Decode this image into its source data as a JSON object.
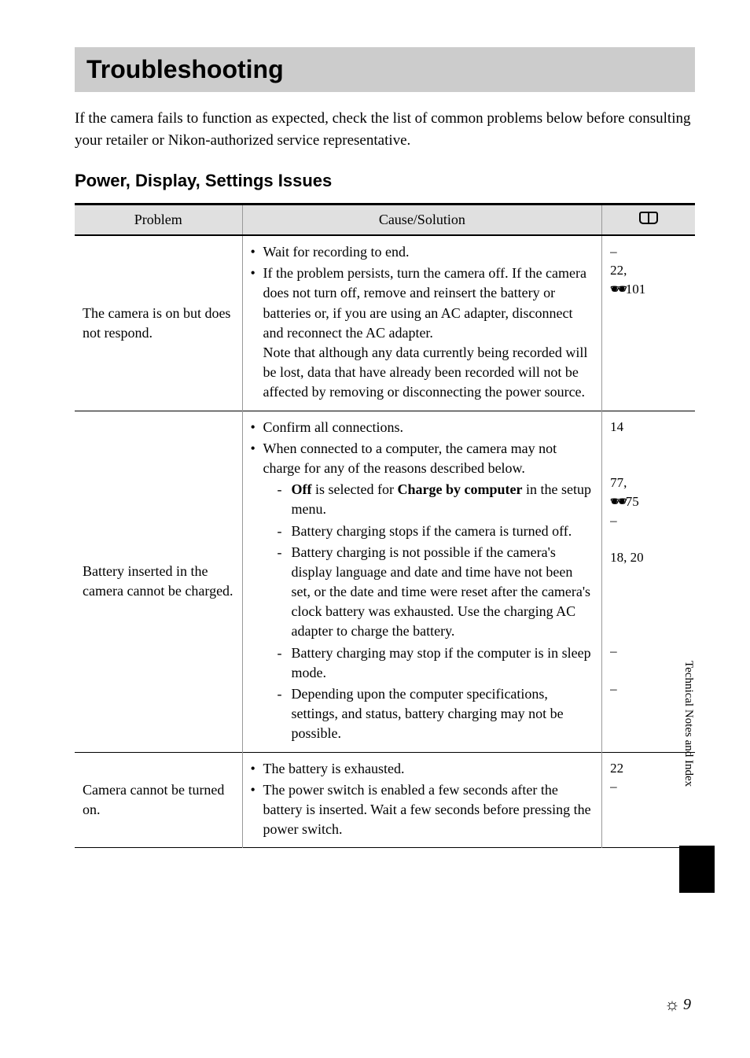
{
  "pageTitle": "Troubleshooting",
  "introText": "If the camera fails to function as expected, check the list of common problems below before consulting your retailer or Nikon-authorized service representative.",
  "sectionTitle": "Power, Display, Settings Issues",
  "table": {
    "headers": {
      "problem": "Problem",
      "cause": "Cause/Solution"
    },
    "rows": [
      {
        "problem": "The camera is on but does not respond.",
        "causes": [
          "Wait for recording to end.",
          "If the problem persists, turn the camera off. If the camera does not turn off, remove and reinsert the battery or batteries or, if you are using an AC adapter, disconnect and reconnect the AC adapter.\nNote that although any data currently being recorded will be lost, data that have already been recorded will not be affected by removing or disconnecting the power source."
        ],
        "refs": [
          "–",
          "22,",
          "🔗101"
        ]
      },
      {
        "problem": "Battery inserted in the camera cannot be charged.",
        "causes": [
          "Confirm all connections.",
          {
            "text": "When connected to a computer, the camera may not charge for any of the reasons described below.",
            "sub": [
              {
                "pre": "Off",
                "mid": " is selected for ",
                "bold2": "Charge by computer",
                "post": " in the setup menu."
              },
              "Battery charging stops if the camera is turned off.",
              "Battery charging is not possible if the camera's display language and date and time have not been set, or the date and time were reset after the camera's clock battery was exhausted. Use the charging AC adapter to charge the battery.",
              "Battery charging may stop if the computer is in sleep mode.",
              "Depending upon the computer specifications, settings, and status, battery charging may not be possible."
            ]
          }
        ],
        "refs": [
          "14",
          " ",
          " ",
          "77,",
          "🔗75",
          "–",
          " ",
          "18, 20",
          " ",
          " ",
          " ",
          " ",
          "–",
          " ",
          "–"
        ]
      },
      {
        "problem": "Camera cannot be turned on.",
        "causes": [
          "The battery is exhausted.",
          "The power switch is enabled a few seconds after the battery is inserted. Wait a few seconds before pressing the power switch."
        ],
        "refs": [
          "22",
          "–"
        ]
      }
    ]
  },
  "sideTabLabel": "Technical Notes and Index",
  "pageNumber": "9"
}
